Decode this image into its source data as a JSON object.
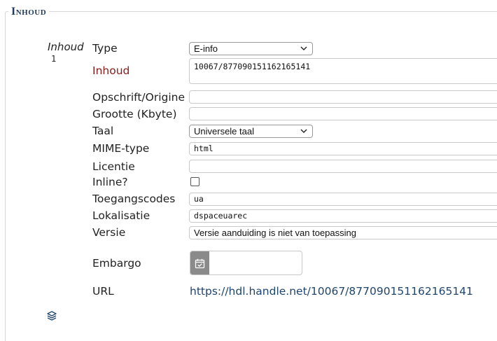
{
  "legend": "Inhoud",
  "group": {
    "label": "Inhoud",
    "index": "1"
  },
  "fields": {
    "type": {
      "label": "Type",
      "value": "E-info"
    },
    "inhoud": {
      "label": "Inhoud",
      "value": "10067/877090151162165141"
    },
    "opschrift": {
      "label": "Opschrift/Origine",
      "value": ""
    },
    "grootte": {
      "label": "Grootte (Kbyte)",
      "value": ""
    },
    "taal": {
      "label": "Taal",
      "value": "Universele taal"
    },
    "mime": {
      "label": "MIME-type",
      "value": "html"
    },
    "licentie": {
      "label": "Licentie",
      "value": ""
    },
    "inline": {
      "label": "Inline?",
      "checked": false
    },
    "toegang": {
      "label": "Toegangscodes",
      "value": "ua"
    },
    "lokalisatie": {
      "label": "Lokalisatie",
      "value": "dspaceuarec"
    },
    "versie": {
      "label": "Versie",
      "value": "Versie aanduiding is niet van toepassing"
    },
    "embargo": {
      "label": "Embargo",
      "value": ""
    },
    "url": {
      "label": "URL",
      "value": "https://hdl.handle.net/10067/877090151162165141"
    }
  },
  "colors": {
    "legend": "#1f3a5a",
    "required": "#8b1a1a",
    "link": "#20466e"
  },
  "icons": {
    "select_arrow": "chevron-down-icon",
    "calendar": "calendar-check-icon",
    "add": "layers-icon"
  }
}
